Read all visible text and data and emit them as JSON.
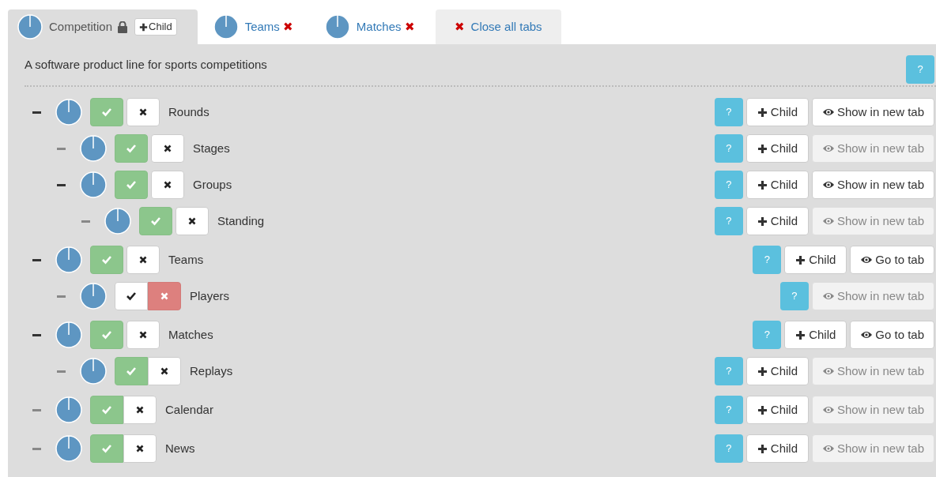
{
  "tabs": [
    {
      "kind": "main",
      "label": "Competition",
      "selected": true,
      "locked": true,
      "child_button": "Child"
    },
    {
      "kind": "feature",
      "label": "Teams",
      "selected": false,
      "close": "✖"
    },
    {
      "kind": "feature",
      "label": "Matches",
      "selected": false,
      "close": "✖"
    },
    {
      "kind": "close_all",
      "label": "Close all tabs",
      "selected": false,
      "close": "✖"
    }
  ],
  "description": "A software product line for sports competitions",
  "help_button": "?",
  "tree": [
    {
      "label": "Rounds",
      "enabled": true,
      "joined": false,
      "help": "?",
      "child_button": "Child",
      "tab_button": {
        "label": "Show in new tab",
        "disabled": false
      },
      "children": [
        {
          "label": "Stages",
          "enabled": true,
          "joined": false,
          "help": "?",
          "child_button": "Child",
          "tab_button": {
            "label": "Show in new tab",
            "disabled": true
          }
        },
        {
          "label": "Groups",
          "enabled": true,
          "joined": false,
          "help": "?",
          "child_button": "Child",
          "tab_button": {
            "label": "Show in new tab",
            "disabled": false
          },
          "children": [
            {
              "label": "Standing",
              "enabled": true,
              "joined": false,
              "help": "?",
              "child_button": "Child",
              "tab_button": {
                "label": "Show in new tab",
                "disabled": true
              }
            }
          ]
        }
      ]
    },
    {
      "label": "Teams",
      "enabled": true,
      "joined": false,
      "help": "?",
      "child_button": "Child",
      "tab_button": {
        "label": "Go to tab",
        "disabled": false
      },
      "children": [
        {
          "label": "Players",
          "enabled": false,
          "joined": true,
          "help": "?",
          "tab_button": {
            "label": "Show in new tab",
            "disabled": true
          }
        }
      ]
    },
    {
      "label": "Matches",
      "enabled": true,
      "joined": false,
      "help": "?",
      "child_button": "Child",
      "tab_button": {
        "label": "Go to tab",
        "disabled": false
      },
      "children": [
        {
          "label": "Replays",
          "enabled": true,
          "joined": true,
          "help": "?",
          "child_button": "Child",
          "tab_button": {
            "label": "Show in new tab",
            "disabled": true
          }
        }
      ]
    },
    {
      "label": "Calendar",
      "enabled": true,
      "joined": true,
      "help": "?",
      "child_button": "Child",
      "tab_button": {
        "label": "Show in new tab",
        "disabled": true
      }
    },
    {
      "label": "News",
      "enabled": true,
      "joined": true,
      "help": "?",
      "child_button": "Child",
      "tab_button": {
        "label": "Show in new tab",
        "disabled": true
      }
    }
  ]
}
